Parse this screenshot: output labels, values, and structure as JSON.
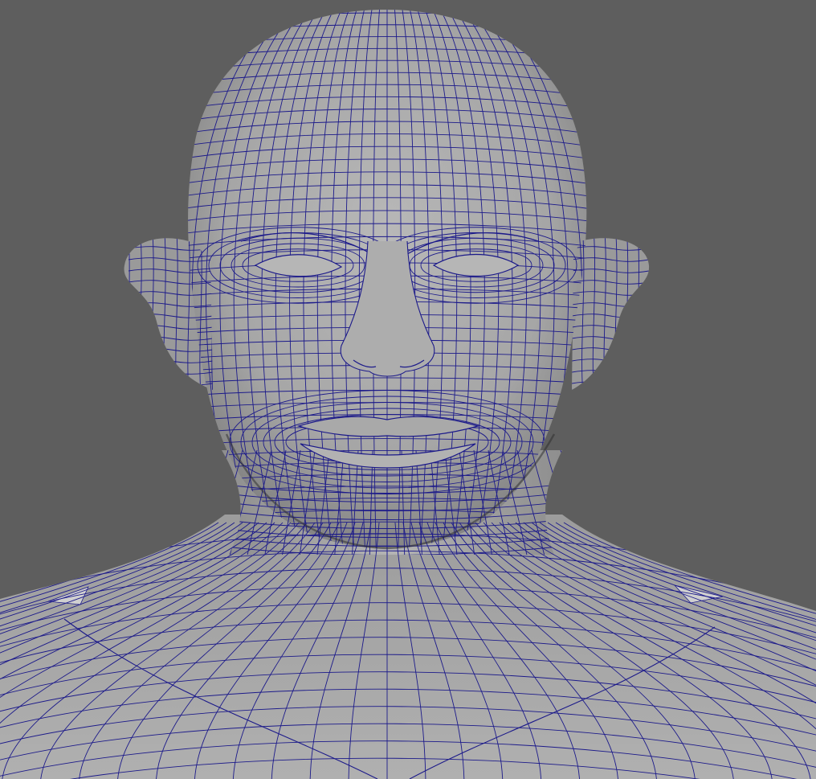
{
  "viewport": {
    "background_color": "#5e5e5e",
    "mesh_fill_color": "#a7a7a7",
    "wireframe_color": "#1c1a8a",
    "display_mode": "wireframe-on-shaded",
    "subject": "male-head-and-shoulders-polygon-mesh"
  }
}
